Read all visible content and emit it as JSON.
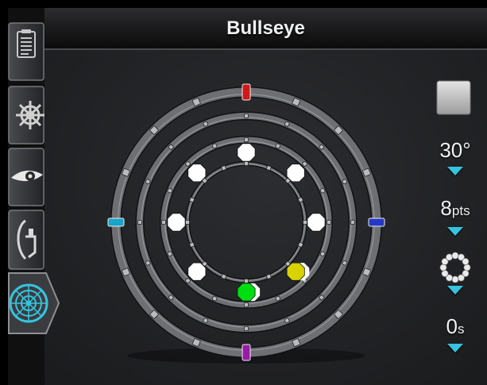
{
  "app": {
    "title": "Bullseye"
  },
  "sidebar": {
    "items": [
      {
        "icon": "clipboard-icon",
        "selected": false
      },
      {
        "icon": "ship-wheel-icon",
        "selected": false
      },
      {
        "icon": "eye-icon",
        "selected": false
      },
      {
        "icon": "spray-hand-icon",
        "selected": false
      },
      {
        "icon": "bullseye-icon",
        "selected": true
      }
    ]
  },
  "controls": {
    "shape_icon": "square-icon",
    "angle_value": "30°",
    "spacing_value": "8",
    "spacing_unit": "pts",
    "pattern_icon": "dotted-ring-icon",
    "time_value": "0",
    "time_unit": "s"
  },
  "targets": [
    {
      "color": "#ffffff"
    },
    {
      "color": "#ffffff"
    },
    {
      "color": "#ffffff"
    },
    {
      "color": "#d8d200"
    },
    {
      "color": "#00dd11"
    },
    {
      "color": "#ffffff"
    },
    {
      "color": "#ffffff"
    },
    {
      "color": "#ffffff"
    }
  ],
  "ring_markers": {
    "top": "#d01818",
    "right": "#2438c8",
    "bottom": "#9a1aa8",
    "left": "#18a4c8"
  },
  "colors": {
    "accent": "#35c4df",
    "background": "#1e1f21"
  }
}
